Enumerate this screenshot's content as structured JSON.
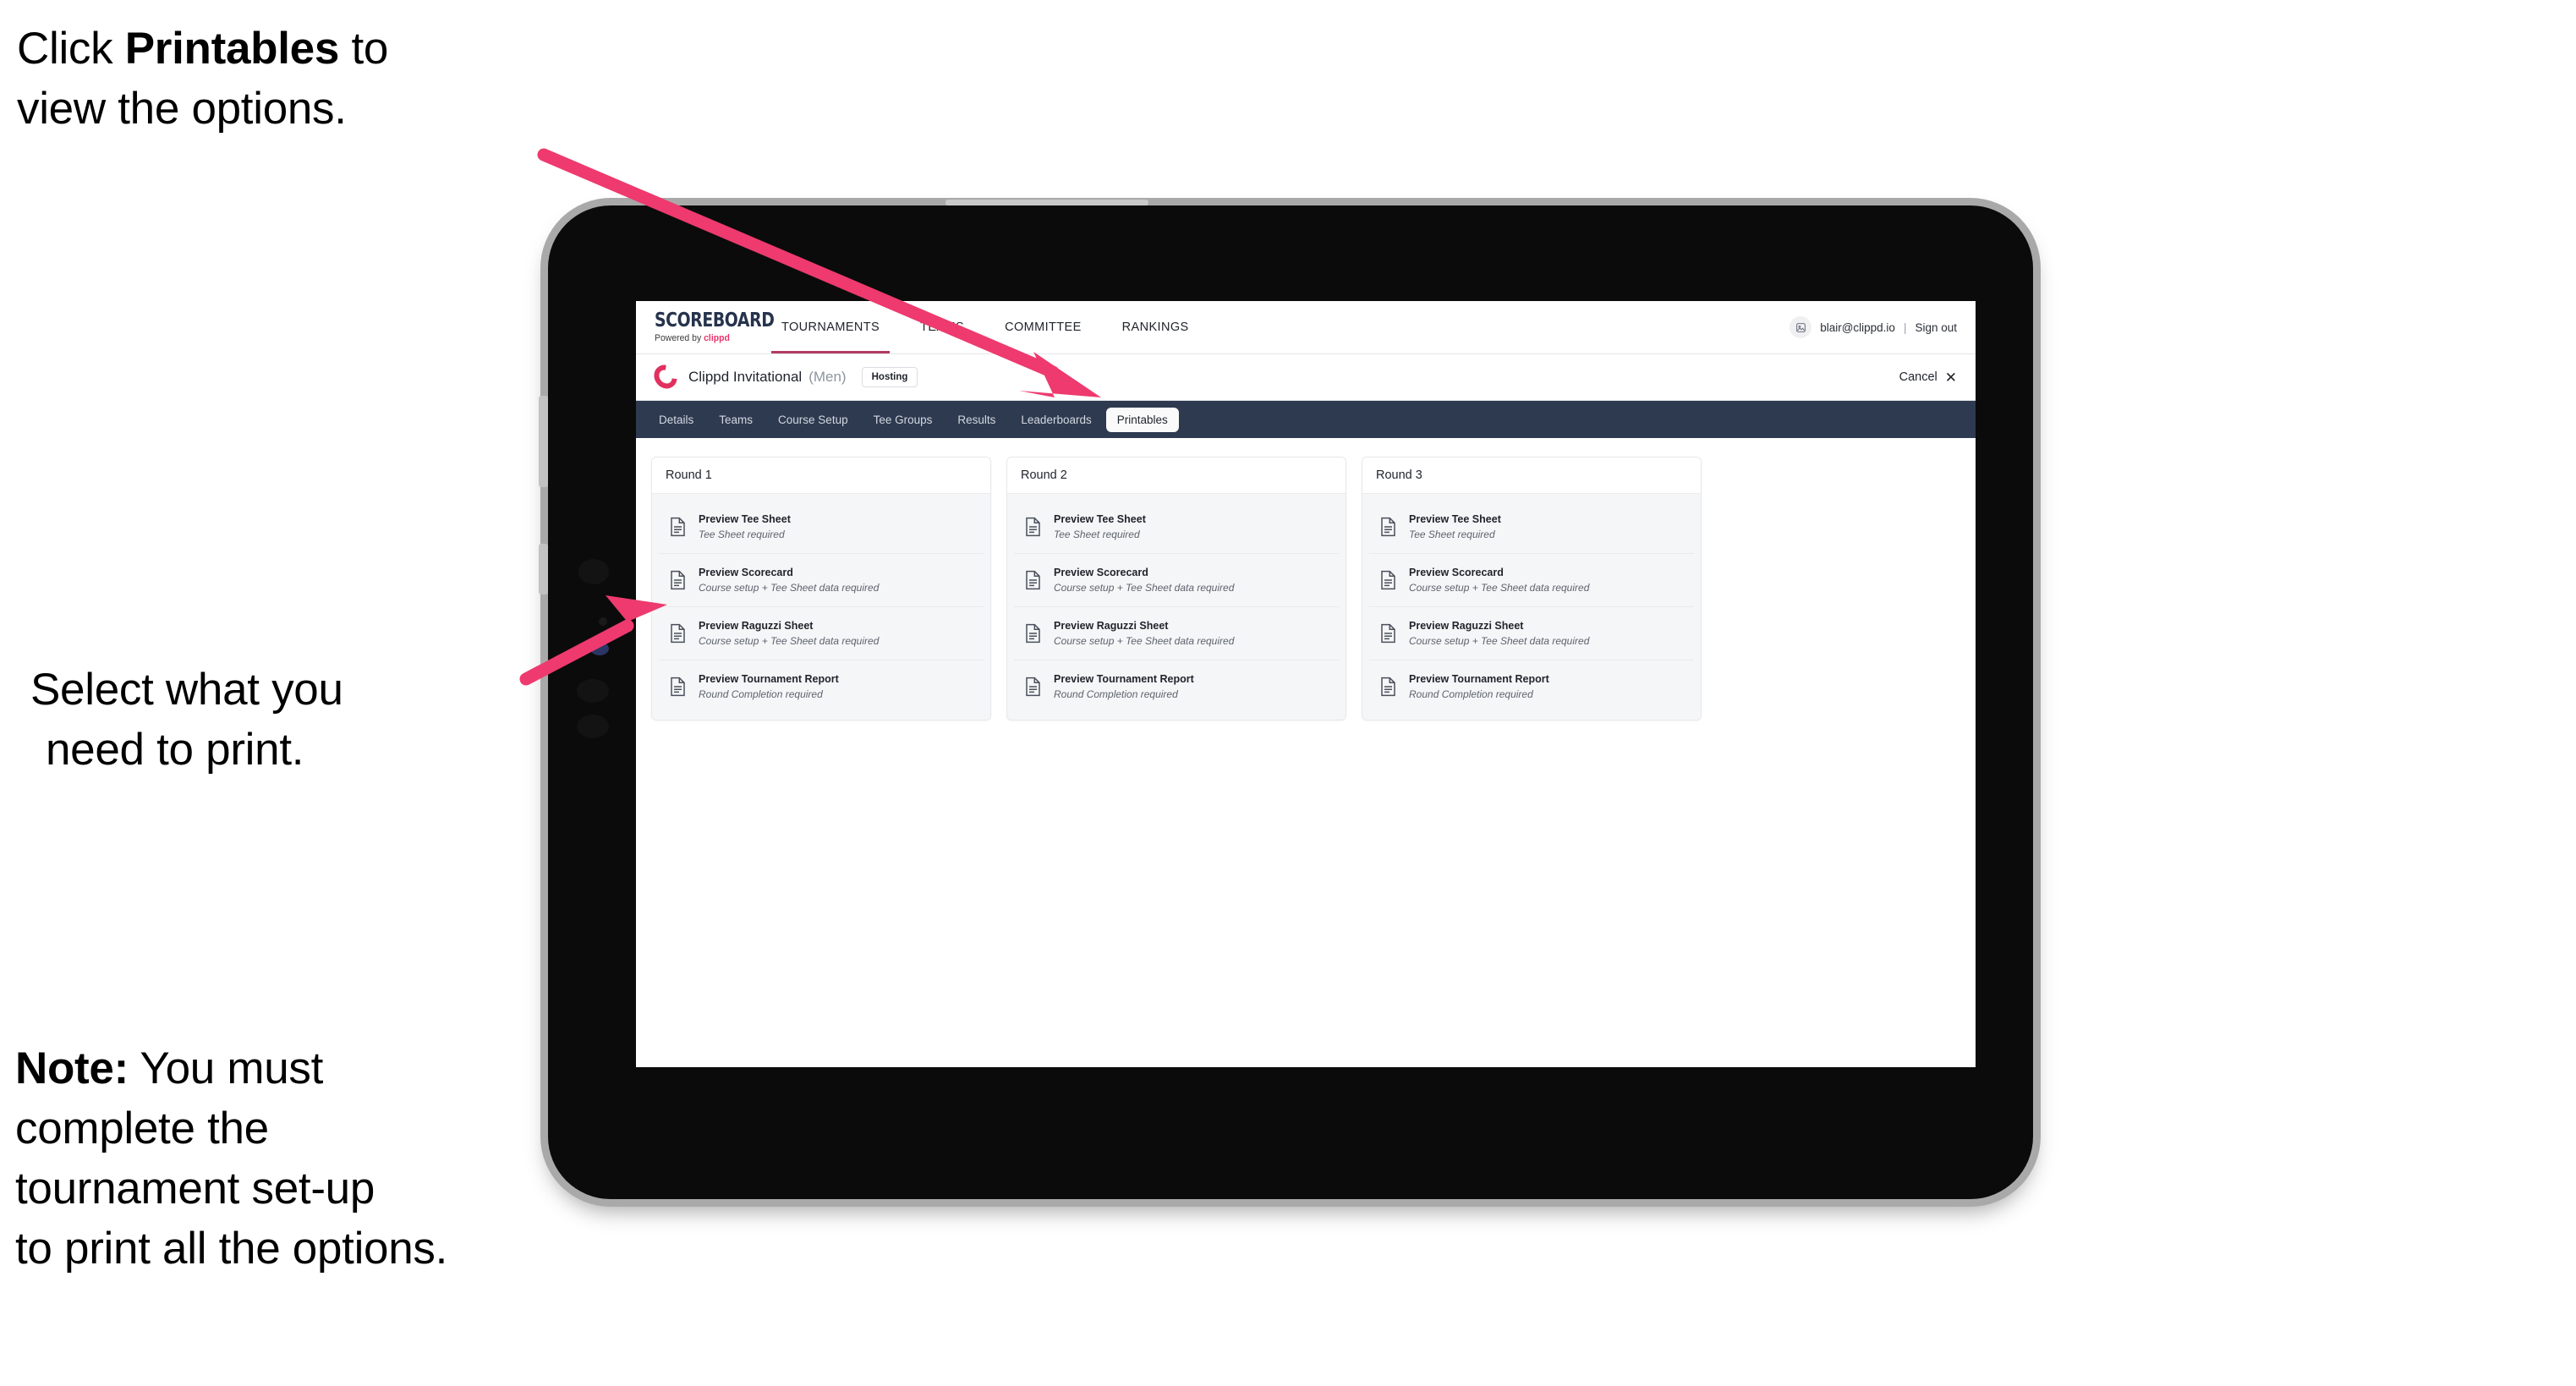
{
  "annotations": {
    "callout_1": {
      "prefix": "Click ",
      "bold": "Printables",
      "suffix": " to",
      "line2": "view the options."
    },
    "callout_2": {
      "line1": "Select what you",
      "line2": "need to print."
    },
    "note": {
      "label": "Note:",
      "line1": " You must",
      "line2": "complete the",
      "line3": "tournament set-up",
      "line4": "to print all the options."
    }
  },
  "app": {
    "brand": {
      "name": "SCOREBOARD",
      "powered_prefix": "Powered by ",
      "powered_brand": "clippd"
    },
    "top_nav": [
      {
        "label": "TOURNAMENTS",
        "active": true
      },
      {
        "label": "TEAMS",
        "active": false
      },
      {
        "label": "COMMITTEE",
        "active": false
      },
      {
        "label": "RANKINGS",
        "active": false
      }
    ],
    "account": {
      "avatar_icon": "user-avatar-icon",
      "email": "blair@clippd.io",
      "separator": "|",
      "sign_out": "Sign out"
    },
    "tournament": {
      "logo_icon": "clippd-c-logo-icon",
      "name": "Clippd Invitational",
      "gender": "(Men)",
      "status_badge": "Hosting",
      "cancel_label": "Cancel",
      "cancel_icon": "close-x-icon"
    },
    "sub_nav": [
      {
        "label": "Details",
        "active": false
      },
      {
        "label": "Teams",
        "active": false
      },
      {
        "label": "Course Setup",
        "active": false
      },
      {
        "label": "Tee Groups",
        "active": false
      },
      {
        "label": "Results",
        "active": false
      },
      {
        "label": "Leaderboards",
        "active": false
      },
      {
        "label": "Printables",
        "active": true
      }
    ],
    "rounds": [
      {
        "title": "Round 1",
        "items": [
          {
            "title": "Preview Tee Sheet",
            "subtitle": "Tee Sheet required",
            "icon": "document-icon"
          },
          {
            "title": "Preview Scorecard",
            "subtitle": "Course setup + Tee Sheet data required",
            "icon": "document-icon"
          },
          {
            "title": "Preview Raguzzi Sheet",
            "subtitle": "Course setup + Tee Sheet data required",
            "icon": "document-icon"
          },
          {
            "title": "Preview Tournament Report",
            "subtitle": "Round Completion required",
            "icon": "document-icon"
          }
        ]
      },
      {
        "title": "Round 2",
        "items": [
          {
            "title": "Preview Tee Sheet",
            "subtitle": "Tee Sheet required",
            "icon": "document-icon"
          },
          {
            "title": "Preview Scorecard",
            "subtitle": "Course setup + Tee Sheet data required",
            "icon": "document-icon"
          },
          {
            "title": "Preview Raguzzi Sheet",
            "subtitle": "Course setup + Tee Sheet data required",
            "icon": "document-icon"
          },
          {
            "title": "Preview Tournament Report",
            "subtitle": "Round Completion required",
            "icon": "document-icon"
          }
        ]
      },
      {
        "title": "Round 3",
        "items": [
          {
            "title": "Preview Tee Sheet",
            "subtitle": "Tee Sheet required",
            "icon": "document-icon"
          },
          {
            "title": "Preview Scorecard",
            "subtitle": "Course setup + Tee Sheet data required",
            "icon": "document-icon"
          },
          {
            "title": "Preview Raguzzi Sheet",
            "subtitle": "Course setup + Tee Sheet data required",
            "icon": "document-icon"
          },
          {
            "title": "Preview Tournament Report",
            "subtitle": "Round Completion required",
            "icon": "document-icon"
          }
        ]
      }
    ]
  },
  "colors": {
    "arrow_pink": "#ee3a6e",
    "subnav_navy": "#2e3a50",
    "brand_navy": "#26334d",
    "clippd_pink": "#e8336d",
    "topnav_underline": "#b33b63"
  }
}
